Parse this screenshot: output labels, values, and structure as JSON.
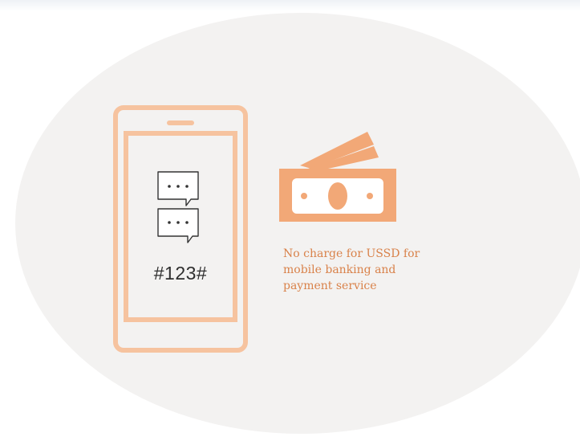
{
  "phone": {
    "ussd_code": "#123#"
  },
  "caption": {
    "lines": [
      "No charge for USSD for",
      "mobile banking and",
      "payment service"
    ]
  },
  "icons": {
    "phone": "smartphone-icon",
    "chat": "chat-bubble-icon",
    "money": "banknotes-icon"
  },
  "colors": {
    "accent": "#f6c39f",
    "accent_dark": "#f2a877",
    "caption": "#d9824a",
    "backdrop": "#f3f2f1"
  }
}
